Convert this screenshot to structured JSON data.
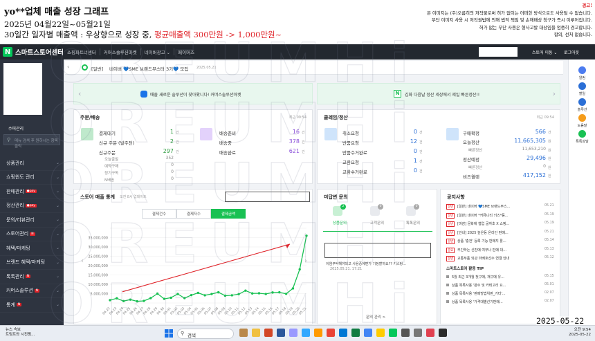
{
  "header": {
    "title": "yo**업체 매출 성장 그래프",
    "line2": "2025년 04월22일~05월21일",
    "line3_prefix": "30일간 일자별 매출액 : 우상향으로 성장 중, ",
    "line3_red": "평균매출액 300만원 -> 1,000만원~",
    "warn_title": "경고!",
    "warn_1": "본 이미지는 (주)오름히의 저작물로써 허가 없이는 어떠한 방식으로도 사용될 수 없습니다.",
    "warn_2": "무단 이미지 사용 시 저작권법에 의해 법적 책임 및 손해배상 청구가 즉시 이루어집니다.",
    "warn_3": "허가 없는 무단 사용은 형사고발 대상임을 엄중히 경고합니다.",
    "warn_4": "합의, 선처 없습니다."
  },
  "topnav": {
    "logo_letter": "N",
    "app_name": "스마트스토어센터",
    "menu": [
      "쇼핑파트너센터",
      "커머스솔루션마켓",
      "네이버광고 ⌄",
      "페이머즈"
    ],
    "right_1": "스토어 이동 ⌄",
    "right_2": "로그아웃"
  },
  "sidebar": {
    "mode": "수퍼관리",
    "search_placeholder": "메뉴 검색 후 원하시는 항목 클릭",
    "items": [
      {
        "label": "상품관리"
      },
      {
        "label": "쇼핑윈도 관리"
      },
      {
        "label": "판매관리",
        "badge": "●pay"
      },
      {
        "label": "정산관리",
        "badge": "●pay"
      },
      {
        "label": "문의/리뷰관리"
      },
      {
        "label": "스토어관리",
        "badge": "N"
      },
      {
        "label": "혜택/마케팅"
      },
      {
        "label": "브랜드 혜택/마케팅"
      },
      {
        "label": "톡톡관리",
        "badge": "N"
      },
      {
        "label": "커머스솔루션",
        "badge": "N"
      },
      {
        "label": "통계",
        "badge": "N"
      }
    ]
  },
  "notice_bar": {
    "tag": "[일반]",
    "text": "네이버 💙SME 브랜드부스터 3기💙 모집",
    "date": "2025.05.21"
  },
  "banners": {
    "left": "매출 새로운 솔루션이 찾아왔니다! 커머스솔루션마켓",
    "right": "김화 다음날 정산 세상에서 제일 빠른정산!!"
  },
  "order_card": {
    "title": "주문/배송",
    "updated": "최근 09:54",
    "col1": [
      {
        "label": "결제대기",
        "value": "1",
        "unit": "건"
      },
      {
        "label": "신규 주문 (발주전)",
        "value": "2",
        "unit": "건"
      },
      {
        "label": "신규주문",
        "value": "297",
        "unit": "건"
      }
    ],
    "col1_sub": [
      {
        "label": "오늘출발",
        "value": "352"
      },
      {
        "label": "예약구매",
        "value": "0"
      },
      {
        "label": "정기구독",
        "value": "0"
      },
      {
        "label": "N배송",
        "value": "0"
      }
    ],
    "col2": [
      {
        "label": "배송준비",
        "value": "16",
        "unit": "건"
      },
      {
        "label": "배송중",
        "value": "378",
        "unit": "건"
      },
      {
        "label": "배송완료",
        "value": "621",
        "unit": "건"
      }
    ]
  },
  "claim_card": {
    "title": "클레임/정산",
    "updated": "최근 09:54",
    "col1": [
      {
        "label": "취소요청",
        "value": "0",
        "unit": "건"
      },
      {
        "label": "반품요청",
        "value": "12",
        "unit": "건"
      },
      {
        "label": "반품수거완료",
        "value": "0",
        "unit": "건"
      },
      {
        "label": "교환요청",
        "value": "1",
        "unit": "건"
      },
      {
        "label": "교환수거완료",
        "value": "0",
        "unit": "건"
      }
    ],
    "col2": [
      {
        "label": "구매확정",
        "value": "566",
        "unit": "건"
      },
      {
        "label": "오늘정산",
        "value": "11,665,305",
        "unit": "원"
      },
      {
        "label": "빠른정산",
        "value": "11,653,210",
        "unit": "원"
      },
      {
        "label": "정산예정",
        "value": "29,496",
        "unit": "원"
      },
      {
        "label": "빠른정산",
        "value": "0",
        "unit": "원"
      },
      {
        "label": "비즈월렛",
        "value": "417,152",
        "unit": "원"
      }
    ]
  },
  "chart_card": {
    "title": "스토어 매출 통계",
    "updated": "오전 8시 업데이트",
    "tabs": [
      "결제건수",
      "결제자수",
      "결제금액"
    ],
    "active_tab": "결제금액"
  },
  "unanswered": {
    "title": "미답변 문의",
    "tabs": [
      {
        "label": "상품문의",
        "count": "2"
      },
      {
        "label": "고객문의",
        "count": "0"
      },
      {
        "label": "톡톡문의",
        "count": "0"
      }
    ],
    "item_text": "이염부탁해야되고 사용중에편가 기정할까요?? 키스탕...",
    "item_date": "2025.05.21. 17:21",
    "more": "문의 관리 >"
  },
  "notices": {
    "title": "공지사항",
    "items": [
      {
        "tag": "일반",
        "text": "[일반] 네이버 💙SME 브랜드부스...",
        "date": "05.21"
      },
      {
        "tag": "일반",
        "text": "[일반] 네이버 *커뮤니티 키즈*등...",
        "date": "05.19"
      },
      {
        "tag": "일반",
        "text": "[마감] 문화에 협업 굴자초 X 쇼핑...",
        "date": "05.19"
      },
      {
        "tag": "일반",
        "text": "[안내] 2025 높은등 온라인 판매...",
        "date": "05.21"
      },
      {
        "tag": "일반",
        "text": "상품 '충전' 등록 기능 판매지 활...",
        "date": "05.14"
      },
      {
        "tag": "중요",
        "text": "주간하는 신판매 여부나 판매 대...",
        "date": "05.13"
      },
      {
        "tag": "일반",
        "text": "교통부품 외관 마베호선수 연결 안내",
        "date": "05.12"
      }
    ],
    "tip_title": "스마트스토어 활용 TIP",
    "tips": [
      {
        "text": "5월 최근 3개월 첫구매, 재구매 유...",
        "date": "05.15"
      },
      {
        "text": "상품 목록사용 '판수 및 카테고리 요...",
        "date": "05.01"
      },
      {
        "text": "상품 목록사용 '판매방법위판_기타'...",
        "date": "02.07"
      },
      {
        "text": "상품 목록사용 '가격대별선기판매...",
        "date": "02.07"
      }
    ]
  },
  "rail": [
    "알림",
    "할일",
    "솔루션",
    "도움말",
    "톡톡상담"
  ],
  "taskbar": {
    "weather_1": "뉴스 속보",
    "weather_2": "트럼프와 시진핑...",
    "search": "검색",
    "time": "오전 9:54",
    "date": "2025-05-22"
  },
  "stamp_date": "2025-05-22",
  "watermark": "OREUMHi",
  "chart_data": {
    "type": "line",
    "title": "",
    "xlabel": "",
    "ylabel": "",
    "ylim": [
      0,
      40000000
    ],
    "yticks": [
      "0",
      "5,000,000",
      "10,000,000",
      "15,000,000",
      "20,000,000",
      "25,000,000",
      "30,000,000",
      "35,000,000",
      "40,000,000"
    ],
    "yticks_visible": [
      "5,000,000",
      "10,000,000",
      "15,000,000",
      "20,000,000",
      "25,000,000",
      "30,000,000",
      "35,000,000"
    ],
    "categories": [
      "04.22",
      "04.23",
      "04.24",
      "04.25",
      "04.26",
      "04.27",
      "04.28",
      "04.29",
      "04.30",
      "05.01",
      "05.02",
      "05.03",
      "05.04",
      "05.05",
      "05.06",
      "05.07",
      "05.08",
      "05.09",
      "05.10",
      "05.11",
      "05.12",
      "05.13",
      "05.14",
      "05.15",
      "05.16",
      "05.17",
      "05.18",
      "05.19",
      "05.20",
      "05.21"
    ],
    "series": [
      {
        "values": [
          1500000,
          2500000,
          1000000,
          1800000,
          900000,
          1100000,
          2600000,
          5000000,
          2200000,
          2800000,
          4800000,
          2600000,
          4200000,
          5400000,
          4100000,
          4800000,
          5700000,
          3900000,
          4100000,
          4700000,
          6600000,
          5100000,
          5200000,
          4800000,
          5600000,
          5700000,
          4900000,
          7800000,
          18000000,
          36000000
        ],
        "color": "#19c153"
      }
    ],
    "annotation": "red arrow indicating upward trend"
  }
}
